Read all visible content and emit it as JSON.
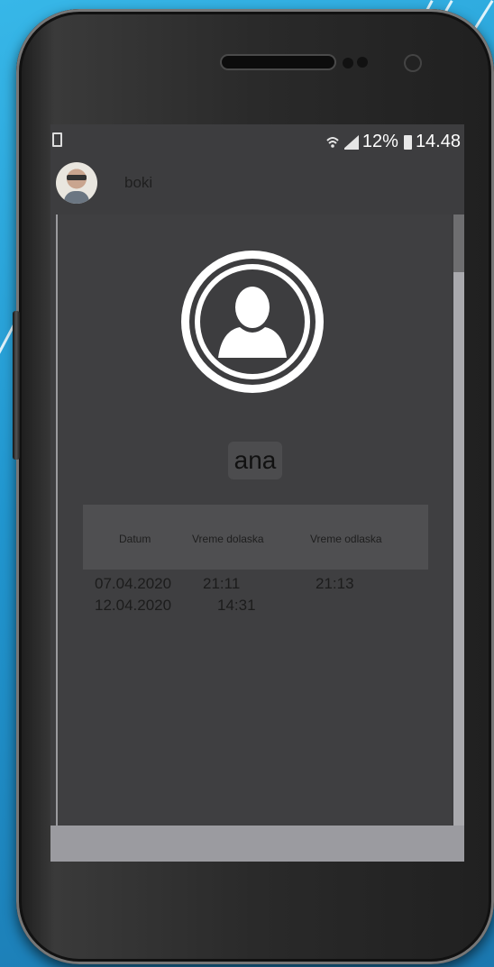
{
  "status_bar": {
    "battery_percent": "12%",
    "time": "14.48",
    "icons": [
      "wifi-icon",
      "signal-icon",
      "battery-icon"
    ]
  },
  "user": {
    "name": "boki"
  },
  "profile": {
    "name": "ana"
  },
  "table": {
    "headers": [
      "Datum",
      "Vreme dolaska",
      "Vreme odlaska"
    ],
    "rows": [
      {
        "date": "07.04.2020",
        "arrival": "21:11",
        "departure": "21:13"
      },
      {
        "date": "12.04.2020",
        "arrival": "14:31",
        "departure": ""
      }
    ]
  },
  "colors": {
    "background": "#2196cf",
    "screen": "#3d3d3f",
    "text": "#1c1c1c"
  }
}
